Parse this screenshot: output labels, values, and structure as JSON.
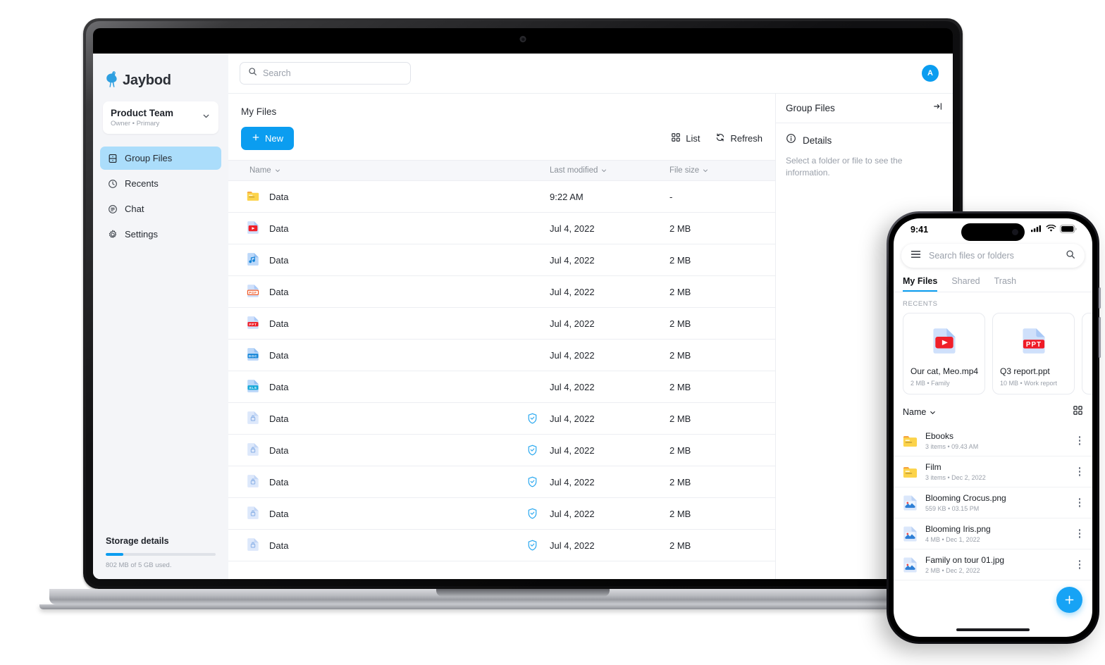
{
  "brand": {
    "name": "Jaybod",
    "logo_icon": "bird-logo-icon"
  },
  "colors": {
    "accent": "#0b9df0",
    "active_nav_bg": "#abddfb",
    "shield": "#2eaaf0"
  },
  "sidebar": {
    "team": {
      "name": "Product Team",
      "subtitle": "Owner • Primary",
      "chevron_icon": "chevron-down-icon"
    },
    "items": [
      {
        "label": "Group Files",
        "icon": "group-files-icon",
        "active": true
      },
      {
        "label": "Recents",
        "icon": "clock-icon",
        "active": false
      },
      {
        "label": "Chat",
        "icon": "chat-icon",
        "active": false
      },
      {
        "label": "Settings",
        "icon": "gear-icon",
        "active": false
      }
    ],
    "storage": {
      "title": "Storage details",
      "text": "802 MB of 5 GB used.",
      "percent": 16
    }
  },
  "topbar": {
    "search_placeholder": "Search",
    "search_icon": "search-icon",
    "avatar_initial": "A"
  },
  "main": {
    "page_title": "My Files",
    "new_button": "New",
    "new_icon": "plus-icon",
    "view_button": {
      "label": "List",
      "icon": "grid-icon"
    },
    "refresh_button": {
      "label": "Refresh",
      "icon": "refresh-icon"
    },
    "columns": [
      {
        "label": "Name",
        "sort_icon": "chevron-down-icon"
      },
      {
        "label": "Last modified",
        "sort_icon": "chevron-down-icon"
      },
      {
        "label": "File size",
        "sort_icon": "chevron-down-icon"
      }
    ],
    "rows": [
      {
        "name": "Data",
        "modified": "9:22 AM",
        "size": "-",
        "icon": "folder-icon",
        "verified": false
      },
      {
        "name": "Data",
        "modified": "Jul 4, 2022",
        "size": "2 MB",
        "icon": "video-icon",
        "verified": false
      },
      {
        "name": "Data",
        "modified": "Jul 4, 2022",
        "size": "2 MB",
        "icon": "audio-icon",
        "verified": false
      },
      {
        "name": "Data",
        "modified": "Jul 4, 2022",
        "size": "2 MB",
        "icon": "pdf-icon",
        "verified": false
      },
      {
        "name": "Data",
        "modified": "Jul 4, 2022",
        "size": "2 MB",
        "icon": "ppt-icon",
        "verified": false
      },
      {
        "name": "Data",
        "modified": "Jul 4, 2022",
        "size": "2 MB",
        "icon": "doc-icon",
        "verified": false
      },
      {
        "name": "Data",
        "modified": "Jul 4, 2022",
        "size": "2 MB",
        "icon": "xls-icon",
        "verified": false
      },
      {
        "name": "Data",
        "modified": "Jul 4, 2022",
        "size": "2 MB",
        "icon": "locked-file-icon",
        "verified": true
      },
      {
        "name": "Data",
        "modified": "Jul 4, 2022",
        "size": "2 MB",
        "icon": "locked-file-icon",
        "verified": true
      },
      {
        "name": "Data",
        "modified": "Jul 4, 2022",
        "size": "2 MB",
        "icon": "locked-file-icon",
        "verified": true
      },
      {
        "name": "Data",
        "modified": "Jul 4, 2022",
        "size": "2 MB",
        "icon": "locked-file-icon",
        "verified": true
      },
      {
        "name": "Data",
        "modified": "Jul 4, 2022",
        "size": "2 MB",
        "icon": "locked-file-icon",
        "verified": true
      }
    ]
  },
  "details": {
    "panel_title": "Group Files",
    "collapse_icon": "collapse-right-icon",
    "section_label": "Details",
    "info_icon": "info-icon",
    "hint": "Select a folder or file to see the information."
  },
  "phone": {
    "status": {
      "time": "9:41",
      "signal_icon": "cellular-icon",
      "wifi_icon": "wifi-icon",
      "battery_icon": "battery-icon"
    },
    "search": {
      "placeholder": "Search files or folders",
      "menu_icon": "hamburger-icon",
      "search_icon": "search-icon"
    },
    "tabs": [
      {
        "label": "My Files",
        "active": true
      },
      {
        "label": "Shared",
        "active": false
      },
      {
        "label": "Trash",
        "active": false
      }
    ],
    "recents_label": "RECENTS",
    "recents": [
      {
        "name": "Our cat, Meo.mp4",
        "meta": "2 MB  •  Family",
        "icon": "video-icon"
      },
      {
        "name": "Q3 report.ppt",
        "meta": "10 MB  •  Work report",
        "icon": "ppt-icon"
      }
    ],
    "sort": {
      "label": "Name",
      "chevron_icon": "chevron-down-icon",
      "view_icon": "grid-icon"
    },
    "items": [
      {
        "name": "Ebooks",
        "meta": "3 items  •  09.43 AM",
        "icon": "folder-icon"
      },
      {
        "name": "Film",
        "meta": "3 items  •  Dec 2, 2022",
        "icon": "folder-icon"
      },
      {
        "name": "Blooming Crocus.png",
        "meta": "559 KB  •  03.15 PM",
        "icon": "image-icon"
      },
      {
        "name": "Blooming Iris.png",
        "meta": "4 MB  •  Dec 1, 2022",
        "icon": "image-icon"
      },
      {
        "name": "Family on tour 01.jpg",
        "meta": "2 MB  •  Dec 2, 2022",
        "icon": "image-icon"
      }
    ],
    "fab": {
      "icon": "plus-icon"
    }
  }
}
